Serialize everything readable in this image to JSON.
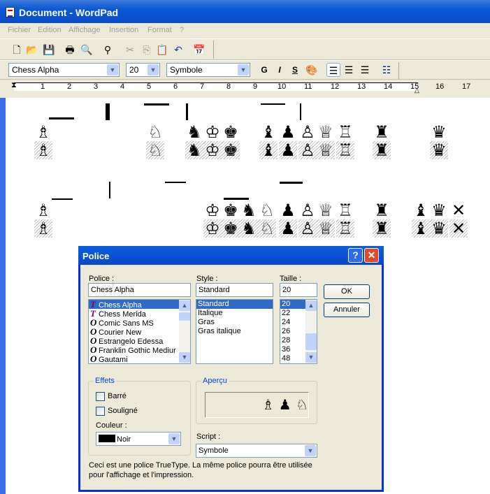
{
  "window": {
    "title": "Document - WordPad"
  },
  "menu": [
    "Fichier",
    "Edition",
    "Affichage",
    "Insertion",
    "Format",
    "?"
  ],
  "toolbar": {
    "icons": [
      "new-icon",
      "open-icon",
      "save-icon",
      "print-icon",
      "print-preview-icon",
      "find-icon",
      "cut-icon",
      "copy-icon",
      "paste-icon",
      "undo-icon",
      "date-time-icon"
    ]
  },
  "format_bar": {
    "font": "Chess Alpha",
    "size": "20",
    "script": "Symbole",
    "bold": "G",
    "italic": "I",
    "underline": "S"
  },
  "ruler": [
    "1",
    "2",
    "3",
    "4",
    "5",
    "6",
    "7",
    "8",
    "9",
    "10",
    "11",
    "12",
    "13",
    "14",
    "15",
    "16",
    "17"
  ],
  "document": {
    "row1": [
      "♗",
      "♘",
      "♞",
      "♔",
      "♚",
      "♝",
      "♟",
      "♙",
      "♕",
      "♖",
      "♜",
      "♛"
    ],
    "row2": [
      "♗",
      "♔",
      "♚",
      "♞",
      "♘",
      "♟",
      "♙",
      "♕",
      "♖",
      "♜",
      "♝",
      "♛",
      "✕"
    ]
  },
  "dialog": {
    "title": "Police",
    "font_label": "Police :",
    "font_value": "Chess Alpha",
    "fonts": [
      "Chess Alpha",
      "Chess Merida",
      "Comic Sans MS",
      "Courier New",
      "Estrangelo Edessa",
      "Franklin Gothic Mediur",
      "Gautami"
    ],
    "style_label": "Style :",
    "style_value": "Standard",
    "styles": [
      "Standard",
      "Italique",
      "Gras",
      "Gras italique"
    ],
    "size_label": "Taille :",
    "size_value": "20",
    "sizes": [
      "20",
      "22",
      "24",
      "26",
      "28",
      "36",
      "48"
    ],
    "ok": "OK",
    "cancel": "Annuler",
    "effects_label": "Effets",
    "strike": "Barré",
    "underline": "Souligné",
    "color_label": "Couleur :",
    "color_value": "Noir",
    "preview_label": "Aperçu",
    "preview_text": "♗ ♟ ♘",
    "script_label": "Script :",
    "script_value": "Symbole",
    "info_line1": "Ceci est une police TrueType. La même police pourra être utilisée",
    "info_line2": "pour l'affichage et l'impression."
  },
  "colors": {
    "titlebar": "#0a58d8",
    "selection": "#316ac5",
    "dialog_bg": "#ece9d8"
  }
}
